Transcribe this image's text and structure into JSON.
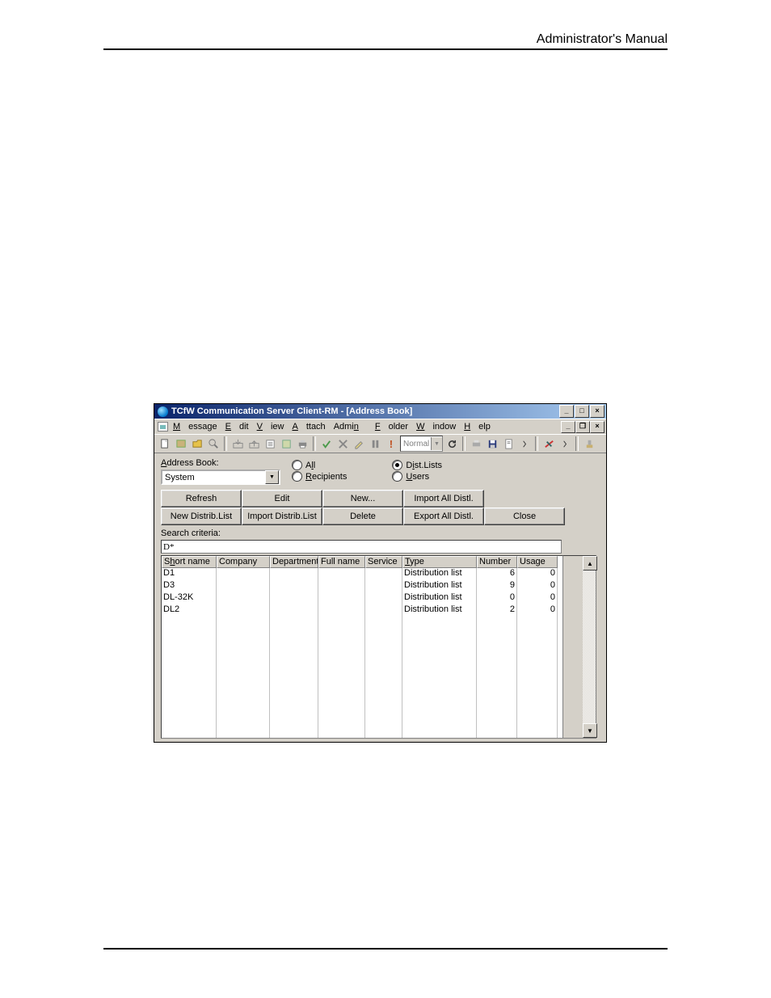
{
  "doc": {
    "header": "Administrator's Manual"
  },
  "window": {
    "title": "TCfW Communication Server Client-RM - [Address Book]",
    "menu": [
      "Message",
      "Edit",
      "View",
      "Attach",
      "Admin",
      "Folder",
      "Window",
      "Help"
    ],
    "priority": "Normal"
  },
  "panel": {
    "ab_label": "Address Book:",
    "ab_value": "System",
    "filter": {
      "all": "All",
      "recipients": "Recipients",
      "dist": "Dist.Lists",
      "users": "Users"
    },
    "buttons": {
      "refresh": "Refresh",
      "edit": "Edit",
      "new": "New...",
      "import_all": "Import All Distl.",
      "new_dl": "New Distrib.List",
      "import_dl": "Import Distrib.List",
      "delete": "Delete",
      "export_all": "Export All Distl.",
      "close": "Close"
    },
    "search_label": "Search criteria:",
    "search_value": "D*"
  },
  "grid": {
    "headers": [
      "Short name",
      "Company",
      "Department",
      "Full name",
      "Service",
      "Type",
      "Number",
      "Usage"
    ],
    "rows": [
      {
        "short": "D1",
        "company": "",
        "dept": "",
        "full": "",
        "service": "",
        "type": "Distribution list",
        "number": "6",
        "usage": "0"
      },
      {
        "short": "D3",
        "company": "",
        "dept": "",
        "full": "",
        "service": "",
        "type": "Distribution list",
        "number": "9",
        "usage": "0"
      },
      {
        "short": "DL-32K",
        "company": "",
        "dept": "",
        "full": "",
        "service": "",
        "type": "Distribution list",
        "number": "0",
        "usage": "0"
      },
      {
        "short": "DL2",
        "company": "",
        "dept": "",
        "full": "",
        "service": "",
        "type": "Distribution list",
        "number": "2",
        "usage": "0"
      }
    ],
    "empty_rows": 10
  }
}
